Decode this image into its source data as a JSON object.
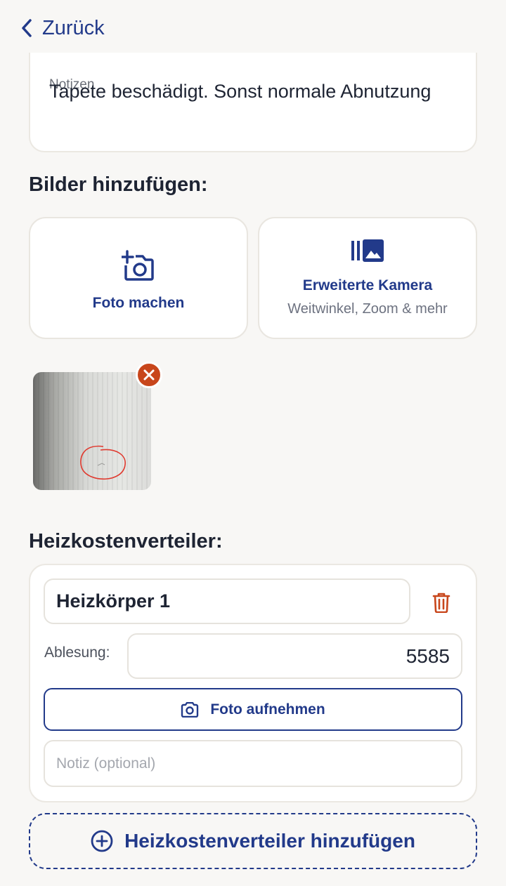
{
  "header": {
    "back_label": "Zurück"
  },
  "notes": {
    "label": "Notizen",
    "text": "Tapete beschädigt. Sonst normale Abnutzung"
  },
  "images": {
    "title": "Bilder hinzufügen:",
    "take_photo_label": "Foto machen",
    "advanced_camera_label": "Erweiterte Kamera",
    "advanced_camera_sub": "Weitwinkel, Zoom & mehr"
  },
  "hkv": {
    "title": "Heizkostenverteiler:",
    "items": [
      {
        "name": "Heizkörper 1",
        "reading_label": "Ablesung:",
        "reading_value": "5585",
        "photo_button_label": "Foto aufnehmen",
        "note_placeholder": "Notiz (optional)"
      }
    ],
    "add_button_label": "Heizkostenverteiler hinzufügen"
  },
  "colors": {
    "primary": "#223a8a",
    "danger": "#c8461b",
    "background": "#f8f7f5"
  },
  "icons": [
    "chevron-left-icon",
    "camera-plus-icon",
    "gallery-icon",
    "close-icon",
    "trash-icon",
    "camera-icon",
    "plus-circle-icon"
  ]
}
